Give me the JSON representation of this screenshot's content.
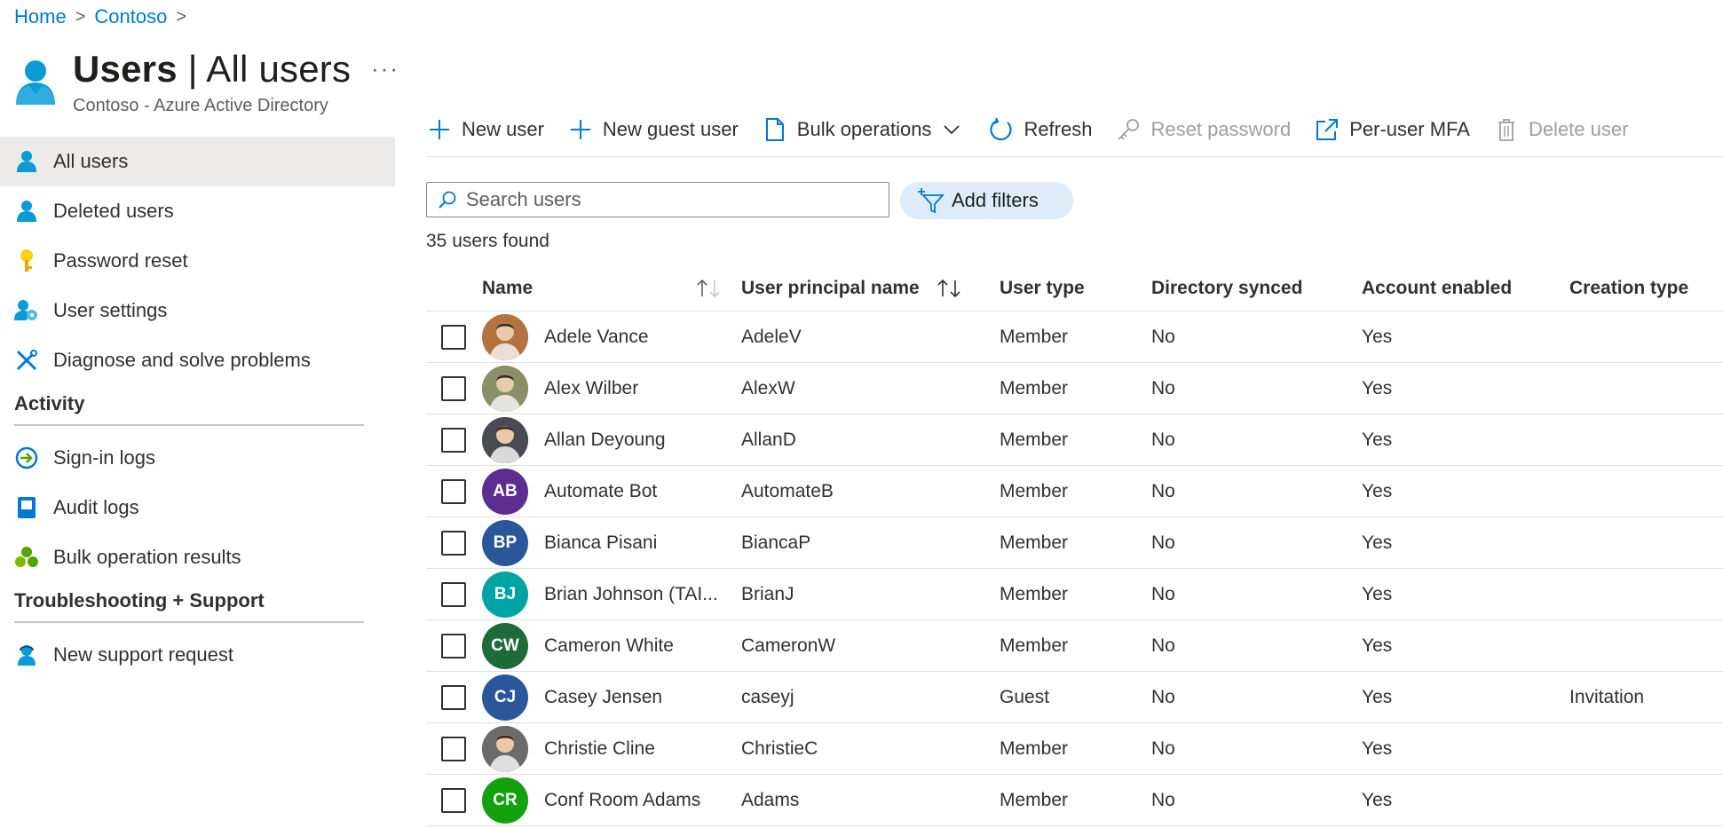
{
  "breadcrumb": {
    "home": "Home",
    "sep": ">",
    "tenant": "Contoso"
  },
  "header": {
    "title_bold": "Users",
    "title_sep": " | ",
    "title_rest": "All users",
    "more": "···",
    "subtitle": "Contoso - Azure Active Directory"
  },
  "sidebar": {
    "items": [
      {
        "label": "All users",
        "icon": "user-icon",
        "active": true
      },
      {
        "label": "Deleted users",
        "icon": "user-icon"
      },
      {
        "label": "Password reset",
        "icon": "key-icon"
      },
      {
        "label": "User settings",
        "icon": "user-settings-icon"
      },
      {
        "label": "Diagnose and solve problems",
        "icon": "wrench-icon"
      }
    ],
    "activity_heading": "Activity",
    "activity": [
      {
        "label": "Sign-in logs",
        "icon": "sign-in-icon"
      },
      {
        "label": "Audit logs",
        "icon": "audit-log-icon"
      },
      {
        "label": "Bulk operation results",
        "icon": "bulk-results-icon"
      }
    ],
    "support_heading": "Troubleshooting + Support",
    "support": [
      {
        "label": "New support request",
        "icon": "support-icon"
      }
    ]
  },
  "toolbar": {
    "new_user": "New user",
    "new_guest_user": "New guest user",
    "bulk_operations": "Bulk operations",
    "refresh": "Refresh",
    "reset_password": "Reset password",
    "per_user_mfa": "Per-user MFA",
    "delete_user": "Delete user"
  },
  "search": {
    "placeholder": "Search users",
    "value": ""
  },
  "filters": {
    "add_label": "Add filters"
  },
  "result_count": "35 users found",
  "table": {
    "columns": [
      "Name",
      "User principal name",
      "User type",
      "Directory synced",
      "Account enabled",
      "Creation type"
    ],
    "rows": [
      {
        "name": "Adele Vance",
        "upn": "AdeleV",
        "type": "Member",
        "synced": "No",
        "enabled": "Yes",
        "creation": "",
        "initials": "",
        "color": "#b4733e"
      },
      {
        "name": "Alex Wilber",
        "upn": "AlexW",
        "type": "Member",
        "synced": "No",
        "enabled": "Yes",
        "creation": "",
        "initials": "",
        "color": "#8a8f6a"
      },
      {
        "name": "Allan Deyoung",
        "upn": "AllanD",
        "type": "Member",
        "synced": "No",
        "enabled": "Yes",
        "creation": "",
        "initials": "",
        "color": "#4a4a52"
      },
      {
        "name": "Automate Bot",
        "upn": "AutomateB",
        "type": "Member",
        "synced": "No",
        "enabled": "Yes",
        "creation": "",
        "initials": "AB",
        "color": "#5c2e91"
      },
      {
        "name": "Bianca Pisani",
        "upn": "BiancaP",
        "type": "Member",
        "synced": "No",
        "enabled": "Yes",
        "creation": "",
        "initials": "BP",
        "color": "#2b579a"
      },
      {
        "name": "Brian Johnson (TAI...",
        "upn": "BrianJ",
        "type": "Member",
        "synced": "No",
        "enabled": "Yes",
        "creation": "",
        "initials": "BJ",
        "color": "#00a3a3"
      },
      {
        "name": "Cameron White",
        "upn": "CameronW",
        "type": "Member",
        "synced": "No",
        "enabled": "Yes",
        "creation": "",
        "initials": "CW",
        "color": "#1e6b3a"
      },
      {
        "name": "Casey Jensen",
        "upn": "caseyj",
        "type": "Guest",
        "synced": "No",
        "enabled": "Yes",
        "creation": "Invitation",
        "initials": "CJ",
        "color": "#2b579a"
      },
      {
        "name": "Christie Cline",
        "upn": "ChristieC",
        "type": "Member",
        "synced": "No",
        "enabled": "Yes",
        "creation": "",
        "initials": "",
        "color": "#6b6b6b"
      },
      {
        "name": "Conf Room Adams",
        "upn": "Adams",
        "type": "Member",
        "synced": "No",
        "enabled": "Yes",
        "creation": "",
        "initials": "CR",
        "color": "#13a10e"
      }
    ]
  },
  "colors": {
    "accent": "#0078d4",
    "active_nav_bg": "#edebe9",
    "filter_pill_bg": "#deecf9"
  }
}
